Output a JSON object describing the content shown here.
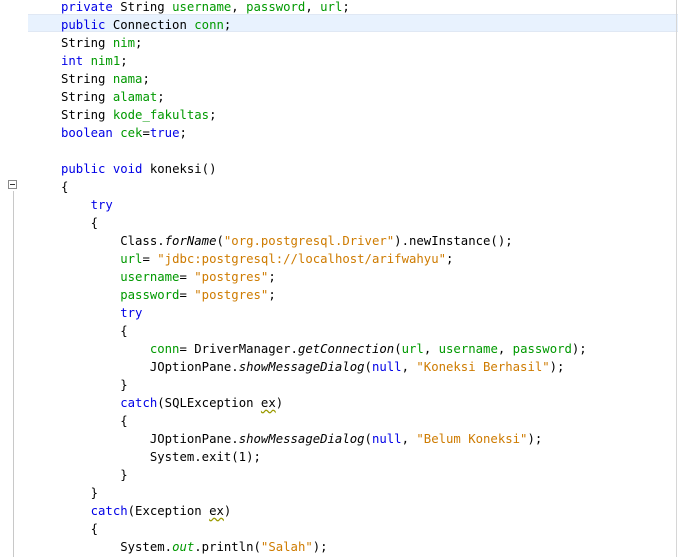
{
  "editor": {
    "lines": [
      [
        {
          "t": "private",
          "c": "kw"
        },
        {
          "t": " String ",
          "c": ""
        },
        {
          "t": "username",
          "c": "fld"
        },
        {
          "t": ", ",
          "c": ""
        },
        {
          "t": "password",
          "c": "fld"
        },
        {
          "t": ", ",
          "c": ""
        },
        {
          "t": "url",
          "c": "fld"
        },
        {
          "t": ";",
          "c": ""
        }
      ],
      [
        {
          "t": "public",
          "c": "kw"
        },
        {
          "t": " Connection ",
          "c": ""
        },
        {
          "t": "conn",
          "c": "fld"
        },
        {
          "t": ";",
          "c": ""
        }
      ],
      [
        {
          "t": "String ",
          "c": ""
        },
        {
          "t": "nim",
          "c": "fld"
        },
        {
          "t": ";",
          "c": ""
        }
      ],
      [
        {
          "t": "int",
          "c": "kw"
        },
        {
          "t": " ",
          "c": ""
        },
        {
          "t": "nim1",
          "c": "fld"
        },
        {
          "t": ";",
          "c": ""
        }
      ],
      [
        {
          "t": "String ",
          "c": ""
        },
        {
          "t": "nama",
          "c": "fld"
        },
        {
          "t": ";",
          "c": ""
        }
      ],
      [
        {
          "t": "String ",
          "c": ""
        },
        {
          "t": "alamat",
          "c": "fld"
        },
        {
          "t": ";",
          "c": ""
        }
      ],
      [
        {
          "t": "String ",
          "c": ""
        },
        {
          "t": "kode_fakultas",
          "c": "fld"
        },
        {
          "t": ";",
          "c": ""
        }
      ],
      [
        {
          "t": "boolean",
          "c": "kw"
        },
        {
          "t": " ",
          "c": ""
        },
        {
          "t": "cek",
          "c": "fld"
        },
        {
          "t": "=",
          "c": ""
        },
        {
          "t": "true",
          "c": "kw"
        },
        {
          "t": ";",
          "c": ""
        }
      ],
      [],
      [
        {
          "t": "public",
          "c": "kw"
        },
        {
          "t": " ",
          "c": ""
        },
        {
          "t": "void",
          "c": "kw"
        },
        {
          "t": " koneksi()",
          "c": ""
        }
      ],
      [
        {
          "t": "{",
          "c": ""
        }
      ],
      [
        {
          "t": "    ",
          "c": ""
        },
        {
          "t": "try",
          "c": "kw"
        }
      ],
      [
        {
          "t": "    {",
          "c": ""
        }
      ],
      [
        {
          "t": "        Class.",
          "c": ""
        },
        {
          "t": "forName",
          "c": "mth"
        },
        {
          "t": "(",
          "c": ""
        },
        {
          "t": "\"org.postgresql.Driver\"",
          "c": "str"
        },
        {
          "t": ").newInstance();",
          "c": ""
        }
      ],
      [
        {
          "t": "        ",
          "c": ""
        },
        {
          "t": "url",
          "c": "fld"
        },
        {
          "t": "= ",
          "c": ""
        },
        {
          "t": "\"jdbc:postgresql://localhost/arifwahyu\"",
          "c": "str"
        },
        {
          "t": ";",
          "c": ""
        }
      ],
      [
        {
          "t": "        ",
          "c": ""
        },
        {
          "t": "username",
          "c": "fld"
        },
        {
          "t": "= ",
          "c": ""
        },
        {
          "t": "\"postgres\"",
          "c": "str"
        },
        {
          "t": ";",
          "c": ""
        }
      ],
      [
        {
          "t": "        ",
          "c": ""
        },
        {
          "t": "password",
          "c": "fld"
        },
        {
          "t": "= ",
          "c": ""
        },
        {
          "t": "\"postgres\"",
          "c": "str"
        },
        {
          "t": ";",
          "c": ""
        }
      ],
      [
        {
          "t": "        ",
          "c": ""
        },
        {
          "t": "try",
          "c": "kw"
        }
      ],
      [
        {
          "t": "        {",
          "c": ""
        }
      ],
      [
        {
          "t": "            ",
          "c": ""
        },
        {
          "t": "conn",
          "c": "fld"
        },
        {
          "t": "= DriverManager.",
          "c": ""
        },
        {
          "t": "getConnection",
          "c": "mth"
        },
        {
          "t": "(",
          "c": ""
        },
        {
          "t": "url",
          "c": "fld"
        },
        {
          "t": ", ",
          "c": ""
        },
        {
          "t": "username",
          "c": "fld"
        },
        {
          "t": ", ",
          "c": ""
        },
        {
          "t": "password",
          "c": "fld"
        },
        {
          "t": ");",
          "c": ""
        }
      ],
      [
        {
          "t": "            JOptionPane.",
          "c": ""
        },
        {
          "t": "showMessageDialog",
          "c": "mth"
        },
        {
          "t": "(",
          "c": ""
        },
        {
          "t": "null",
          "c": "kw"
        },
        {
          "t": ", ",
          "c": ""
        },
        {
          "t": "\"Koneksi Berhasil\"",
          "c": "str"
        },
        {
          "t": ");",
          "c": ""
        }
      ],
      [
        {
          "t": "        }",
          "c": ""
        }
      ],
      [
        {
          "t": "        ",
          "c": ""
        },
        {
          "t": "catch",
          "c": "kw"
        },
        {
          "t": "(SQLException ",
          "c": ""
        },
        {
          "t": "ex",
          "c": "warn"
        },
        {
          "t": ")",
          "c": ""
        }
      ],
      [
        {
          "t": "        {",
          "c": ""
        }
      ],
      [
        {
          "t": "            JOptionPane.",
          "c": ""
        },
        {
          "t": "showMessageDialog",
          "c": "mth"
        },
        {
          "t": "(",
          "c": ""
        },
        {
          "t": "null",
          "c": "kw"
        },
        {
          "t": ", ",
          "c": ""
        },
        {
          "t": "\"Belum Koneksi\"",
          "c": "str"
        },
        {
          "t": ");",
          "c": ""
        }
      ],
      [
        {
          "t": "            System.exit(1);",
          "c": ""
        }
      ],
      [
        {
          "t": "        }",
          "c": ""
        }
      ],
      [
        {
          "t": "    }",
          "c": ""
        }
      ],
      [
        {
          "t": "    ",
          "c": ""
        },
        {
          "t": "catch",
          "c": "kw"
        },
        {
          "t": "(Exception ",
          "c": ""
        },
        {
          "t": "ex",
          "c": "warn"
        },
        {
          "t": ")",
          "c": ""
        }
      ],
      [
        {
          "t": "    {",
          "c": ""
        }
      ],
      [
        {
          "t": "        System.",
          "c": ""
        },
        {
          "t": "out",
          "c": "fld mth"
        },
        {
          "t": ".println(",
          "c": ""
        },
        {
          "t": "\"Salah\"",
          "c": "str"
        },
        {
          "t": ");",
          "c": ""
        }
      ]
    ],
    "colors": {
      "keyword": "#0000e6",
      "field": "#009900",
      "string": "#ce7b00",
      "current_line": "#e8f2fe"
    }
  },
  "gutter": {
    "fold_icon": "fold-collapse-icon"
  }
}
